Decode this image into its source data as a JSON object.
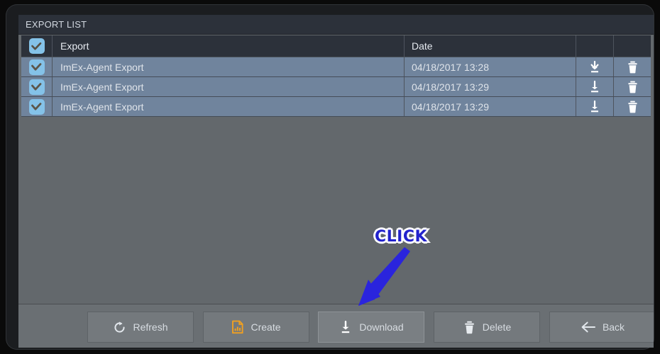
{
  "window": {
    "title": "EXPORT LIST"
  },
  "table": {
    "columns": [
      {
        "key": "check",
        "label": ""
      },
      {
        "key": "name",
        "label": "Export"
      },
      {
        "key": "date",
        "label": "Date"
      },
      {
        "key": "download",
        "label": ""
      },
      {
        "key": "delete",
        "label": ""
      }
    ],
    "header_checkbox_icon": "checkmark-icon",
    "rows": [
      {
        "checkbox_icon": "checkmark-icon",
        "name": "ImEx-Agent Export",
        "date": "04/18/2017 13:28",
        "download_icon": "download-icon",
        "delete_icon": "trash-icon"
      },
      {
        "checkbox_icon": "checkmark-icon",
        "name": "ImEx-Agent Export",
        "date": "04/18/2017 13:29",
        "download_icon": "download-icon",
        "delete_icon": "trash-icon"
      },
      {
        "checkbox_icon": "checkmark-icon",
        "name": "ImEx-Agent Export",
        "date": "04/18/2017 13:29",
        "download_icon": "download-icon",
        "delete_icon": "trash-icon"
      }
    ]
  },
  "toolbar": {
    "buttons": [
      {
        "label": "Refresh",
        "icon": "refresh-icon"
      },
      {
        "label": "Create",
        "icon": "create-report-icon"
      },
      {
        "label": "Download",
        "icon": "download-icon"
      },
      {
        "label": "Delete",
        "icon": "trash-icon"
      },
      {
        "label": "Back",
        "icon": "arrow-left-icon"
      }
    ]
  },
  "annotation": {
    "label": "CLICK",
    "arrow_icon": "arrow-down-left-icon"
  },
  "colors": {
    "titlebar": "#2c313a",
    "row": "#70849d",
    "content_bg": "#63686c",
    "footer": "#6a6f73",
    "checkbox": "#84c2e8",
    "accent_orange": "#f0a021",
    "annotation_blue": "#2222cc"
  }
}
